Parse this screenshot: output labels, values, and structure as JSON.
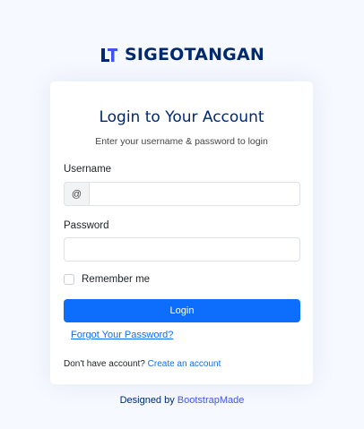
{
  "brand": {
    "name": "SIGEOTANGAN",
    "color": "#012970"
  },
  "card": {
    "title": "Login to Your Account",
    "subtitle": "Enter your username & password to login"
  },
  "form": {
    "username_label": "Username",
    "username_prefix": "@",
    "username_value": "",
    "password_label": "Password",
    "password_value": "",
    "remember_label": "Remember me",
    "remember_checked": false,
    "login_label": "Login",
    "forgot_label": "Forgot Your Password?"
  },
  "signup": {
    "prompt": "Don't have account?",
    "link_label": "Create an account"
  },
  "credits": {
    "prefix": "Designed by",
    "link_label": "BootstrapMade"
  },
  "colors": {
    "background": "#f6f9ff",
    "primary": "#0d6efd",
    "brand": "#012970",
    "credit_link": "#4154f1"
  },
  "icons": {
    "logo": "sigeotangan-logo-icon"
  }
}
